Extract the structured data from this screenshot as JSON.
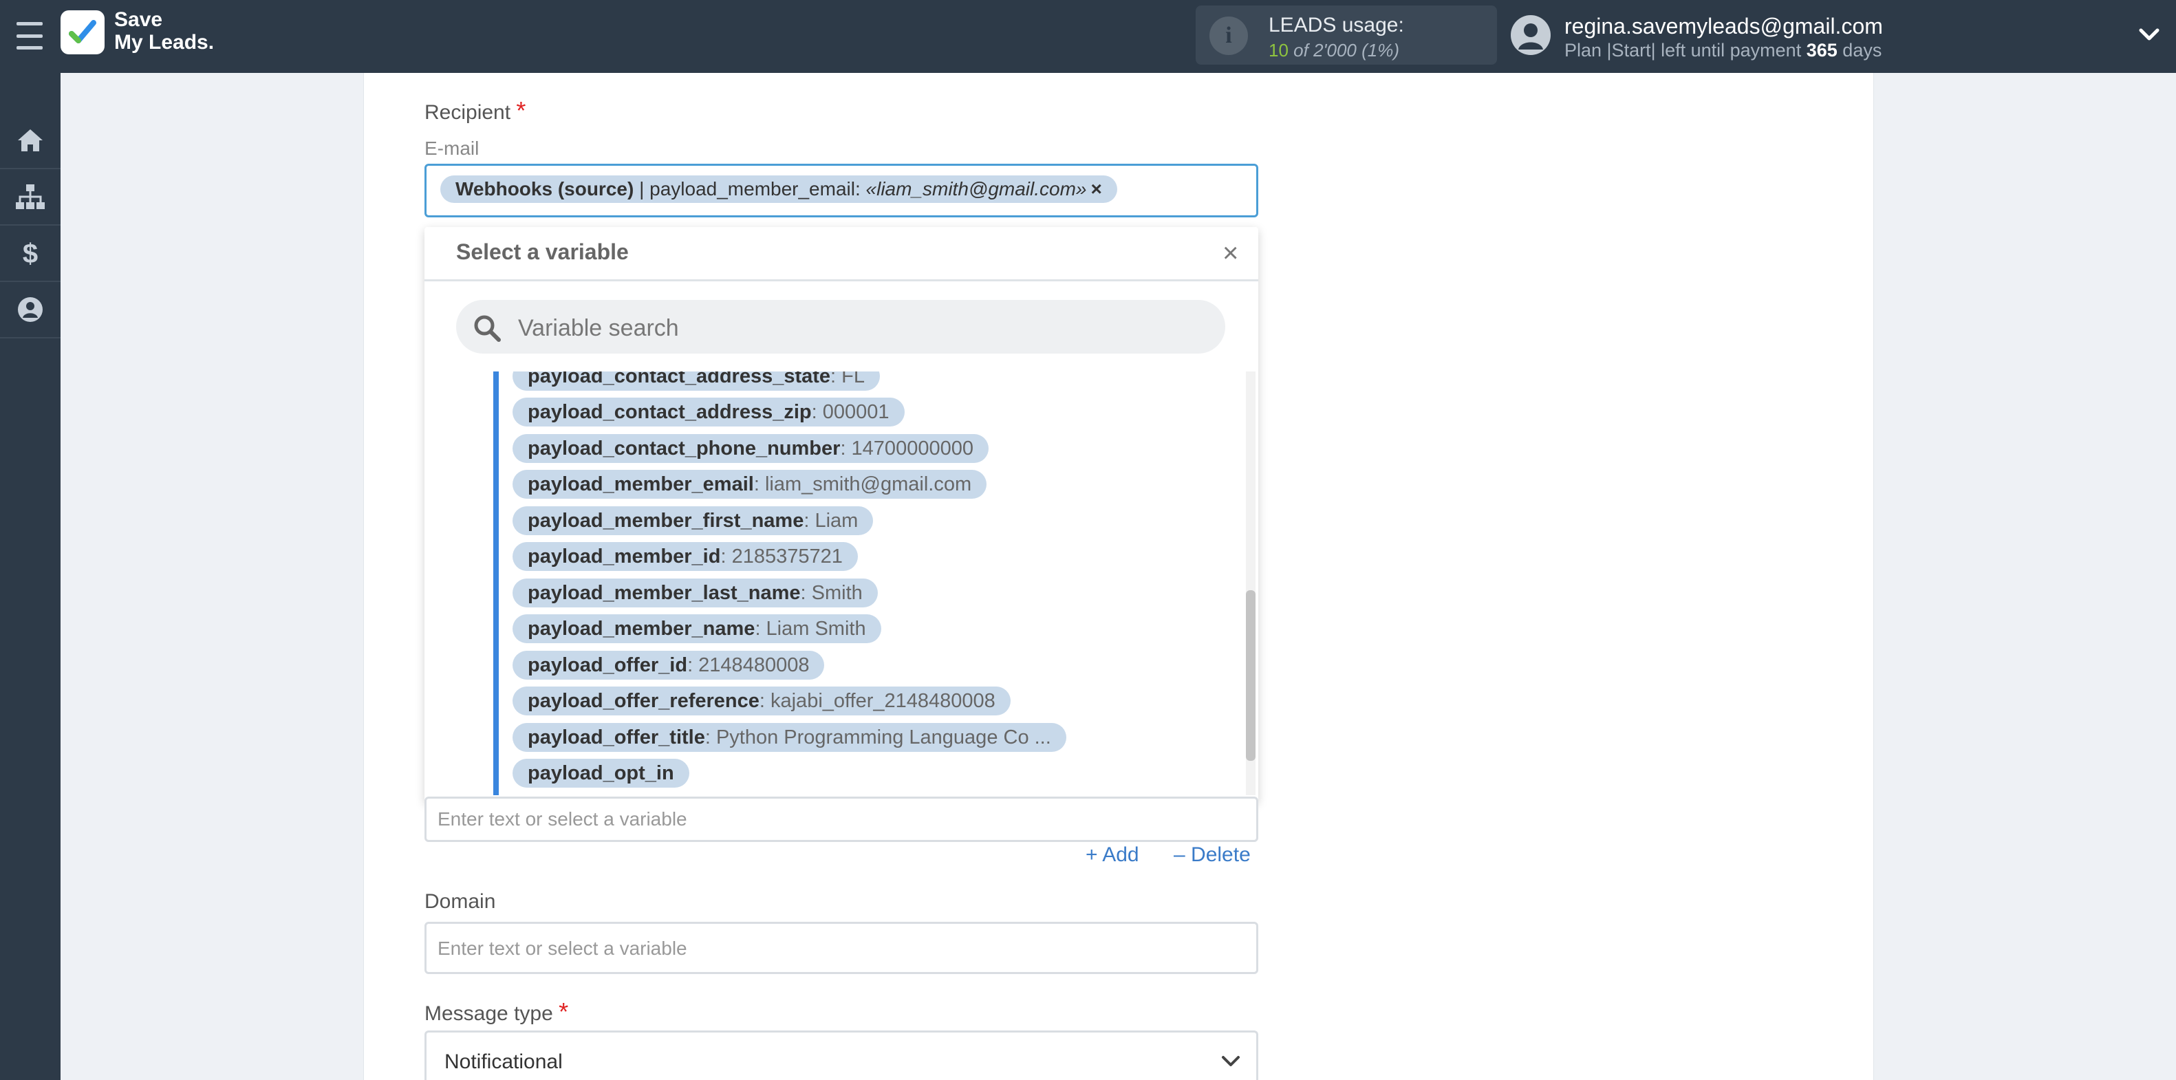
{
  "header": {
    "logo_line1": "Save",
    "logo_line2": "My Leads.",
    "usage_label": "LEADS usage:",
    "usage_used": "10",
    "usage_of": "of 2'000",
    "usage_pct": "(1%)",
    "user_email": "regina.savemyleads@gmail.com",
    "plan_prefix": "Plan |Start| left until payment",
    "plan_days": "365",
    "plan_suffix": "days"
  },
  "sidebar": {
    "items": [
      "home-icon",
      "sitemap-icon",
      "dollar-icon",
      "user-icon"
    ]
  },
  "form": {
    "recipient_label": "Recipient",
    "required_mark": "*",
    "email_sublabel": "E-mail",
    "email_chip": {
      "source": "Webhooks (source)",
      "separator": " | payload_member_email: ",
      "value": "«liam_smith@gmail.com»",
      "remove": "×"
    },
    "second_field_placeholder": "Enter text or select a variable",
    "add_label": "Add",
    "delete_label": "Delete",
    "domain_label": "Domain",
    "domain_placeholder": "Enter text or select a variable",
    "message_type_label": "Message type",
    "message_type_value": "Notificational"
  },
  "variable_picker": {
    "title": "Select a variable",
    "close": "×",
    "search_placeholder": "Variable search",
    "items": [
      {
        "name": "payload_contact_address_state",
        "value": ": FL"
      },
      {
        "name": "payload_contact_address_zip",
        "value": ": 000001"
      },
      {
        "name": "payload_contact_phone_number",
        "value": ": 14700000000"
      },
      {
        "name": "payload_member_email",
        "value": ": liam_smith@gmail.com"
      },
      {
        "name": "payload_member_first_name",
        "value": ": Liam"
      },
      {
        "name": "payload_member_id",
        "value": ": 2185375721"
      },
      {
        "name": "payload_member_last_name",
        "value": ": Smith"
      },
      {
        "name": "payload_member_name",
        "value": ": Liam Smith"
      },
      {
        "name": "payload_offer_id",
        "value": ": 2148480008"
      },
      {
        "name": "payload_offer_reference",
        "value": ": kajabi_offer_2148480008"
      },
      {
        "name": "payload_offer_title",
        "value": ": Python Programming Language Co ..."
      },
      {
        "name": "payload_opt_in",
        "value": ""
      }
    ]
  },
  "colors": {
    "topbar": "#2d3a48",
    "accent_blue": "#3a86de",
    "chip_bg": "#c8d9ea",
    "required_red": "#e02424",
    "usage_green": "#8fc43f"
  }
}
